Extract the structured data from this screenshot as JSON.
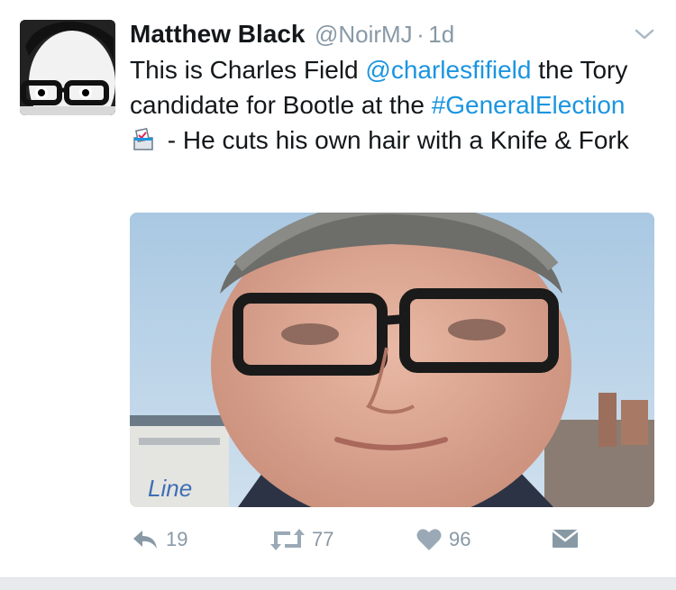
{
  "tweet": {
    "author_name": "Matthew Black",
    "handle": "@NoirMJ",
    "separator": "·",
    "time": "1d",
    "text_1": "This is Charles Field ",
    "mention": "@charlesfifield",
    "text_2": " the Tory candidate for Bootle at the ",
    "hashtag": "#GeneralElection",
    "text_3": " - He cuts his own hair with a Knife & Fork"
  },
  "actions": {
    "reply_count": "19",
    "retweet_count": "77",
    "like_count": "96"
  },
  "icons": {
    "avatar": "avatar-cartoon-glasses",
    "caret": "chevron-down-icon",
    "ballot": "ballot-box-emoji",
    "reply": "reply-icon",
    "retweet": "retweet-icon",
    "like": "heart-icon",
    "dm": "envelope-icon"
  },
  "colors": {
    "link": "#1b95e0",
    "muted": "#8899a6",
    "text": "#14171a",
    "retweet_icon": "#9aa9b5"
  }
}
